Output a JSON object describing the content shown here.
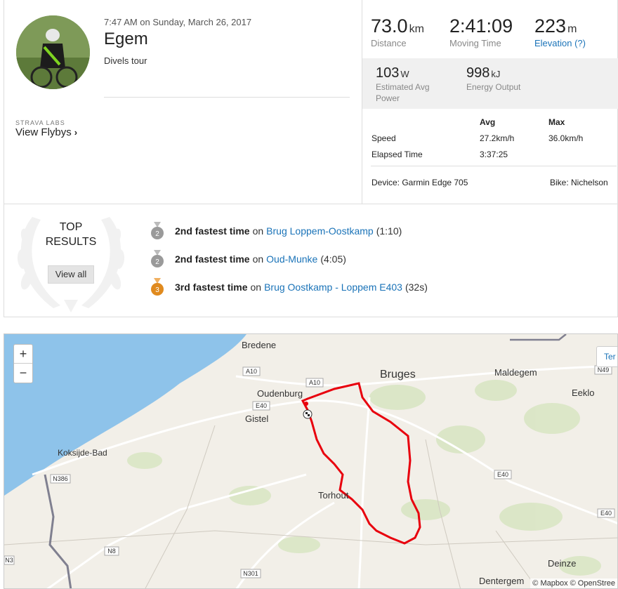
{
  "activity": {
    "date": "7:47 AM on Sunday, March 26, 2017",
    "title": "Egem",
    "description": "Divels tour",
    "labs_label": "STRAVA LABS",
    "flybys_label": "View Flybys"
  },
  "stats": {
    "distance": {
      "value": "73.0",
      "unit": "km",
      "label": "Distance"
    },
    "moving_time": {
      "value": "2:41:09",
      "label": "Moving Time"
    },
    "elevation": {
      "value": "223",
      "unit": "m",
      "label": "Elevation (?)"
    },
    "power": {
      "value": "103",
      "unit": "W",
      "label_1": "Estimated Avg",
      "label_2": "Power"
    },
    "energy": {
      "value": "998",
      "unit": "kJ",
      "label": "Energy Output"
    }
  },
  "table": {
    "headers": [
      "Avg",
      "Max"
    ],
    "rows": [
      {
        "label": "Speed",
        "avg": "27.2km/h",
        "max": "36.0km/h"
      },
      {
        "label": "Elapsed Time",
        "avg": "3:37:25",
        "max": ""
      }
    ],
    "device": "Device: Garmin Edge 705",
    "bike": "Bike: Nichelson"
  },
  "results": {
    "heading_1": "TOP",
    "heading_2": "RESULTS",
    "view_all": "View all",
    "items": [
      {
        "medal": "2",
        "rank": "2nd fastest time",
        "on": "on",
        "segment": "Brug Loppem-Oostkamp",
        "time": "(1:10)",
        "color": "#9a9a9a"
      },
      {
        "medal": "2",
        "rank": "2nd fastest time",
        "on": "on",
        "segment": "Oud-Munke",
        "time": "(4:05)",
        "color": "#9a9a9a"
      },
      {
        "medal": "3",
        "rank": "3rd fastest time",
        "on": "on",
        "segment": "Brug Oostkamp - Loppem E403",
        "time": "(32s)",
        "color": "#e08a1e"
      }
    ]
  },
  "map": {
    "zoom_in": "+",
    "zoom_out": "−",
    "terrain": "Ter",
    "attribution": "© Mapbox © OpenStree",
    "cities": [
      "Bredene",
      "Bruges",
      "Oudenburg",
      "Gistel",
      "Maldegem",
      "Eeklo",
      "Koksijde-Bad",
      "Torhout",
      "Deinze",
      "Dentergem"
    ],
    "roads": [
      "A10",
      "A10",
      "E40",
      "E40",
      "E40",
      "N49",
      "N386",
      "N8",
      "N301",
      "N3"
    ],
    "route_color": "#e8000d"
  }
}
